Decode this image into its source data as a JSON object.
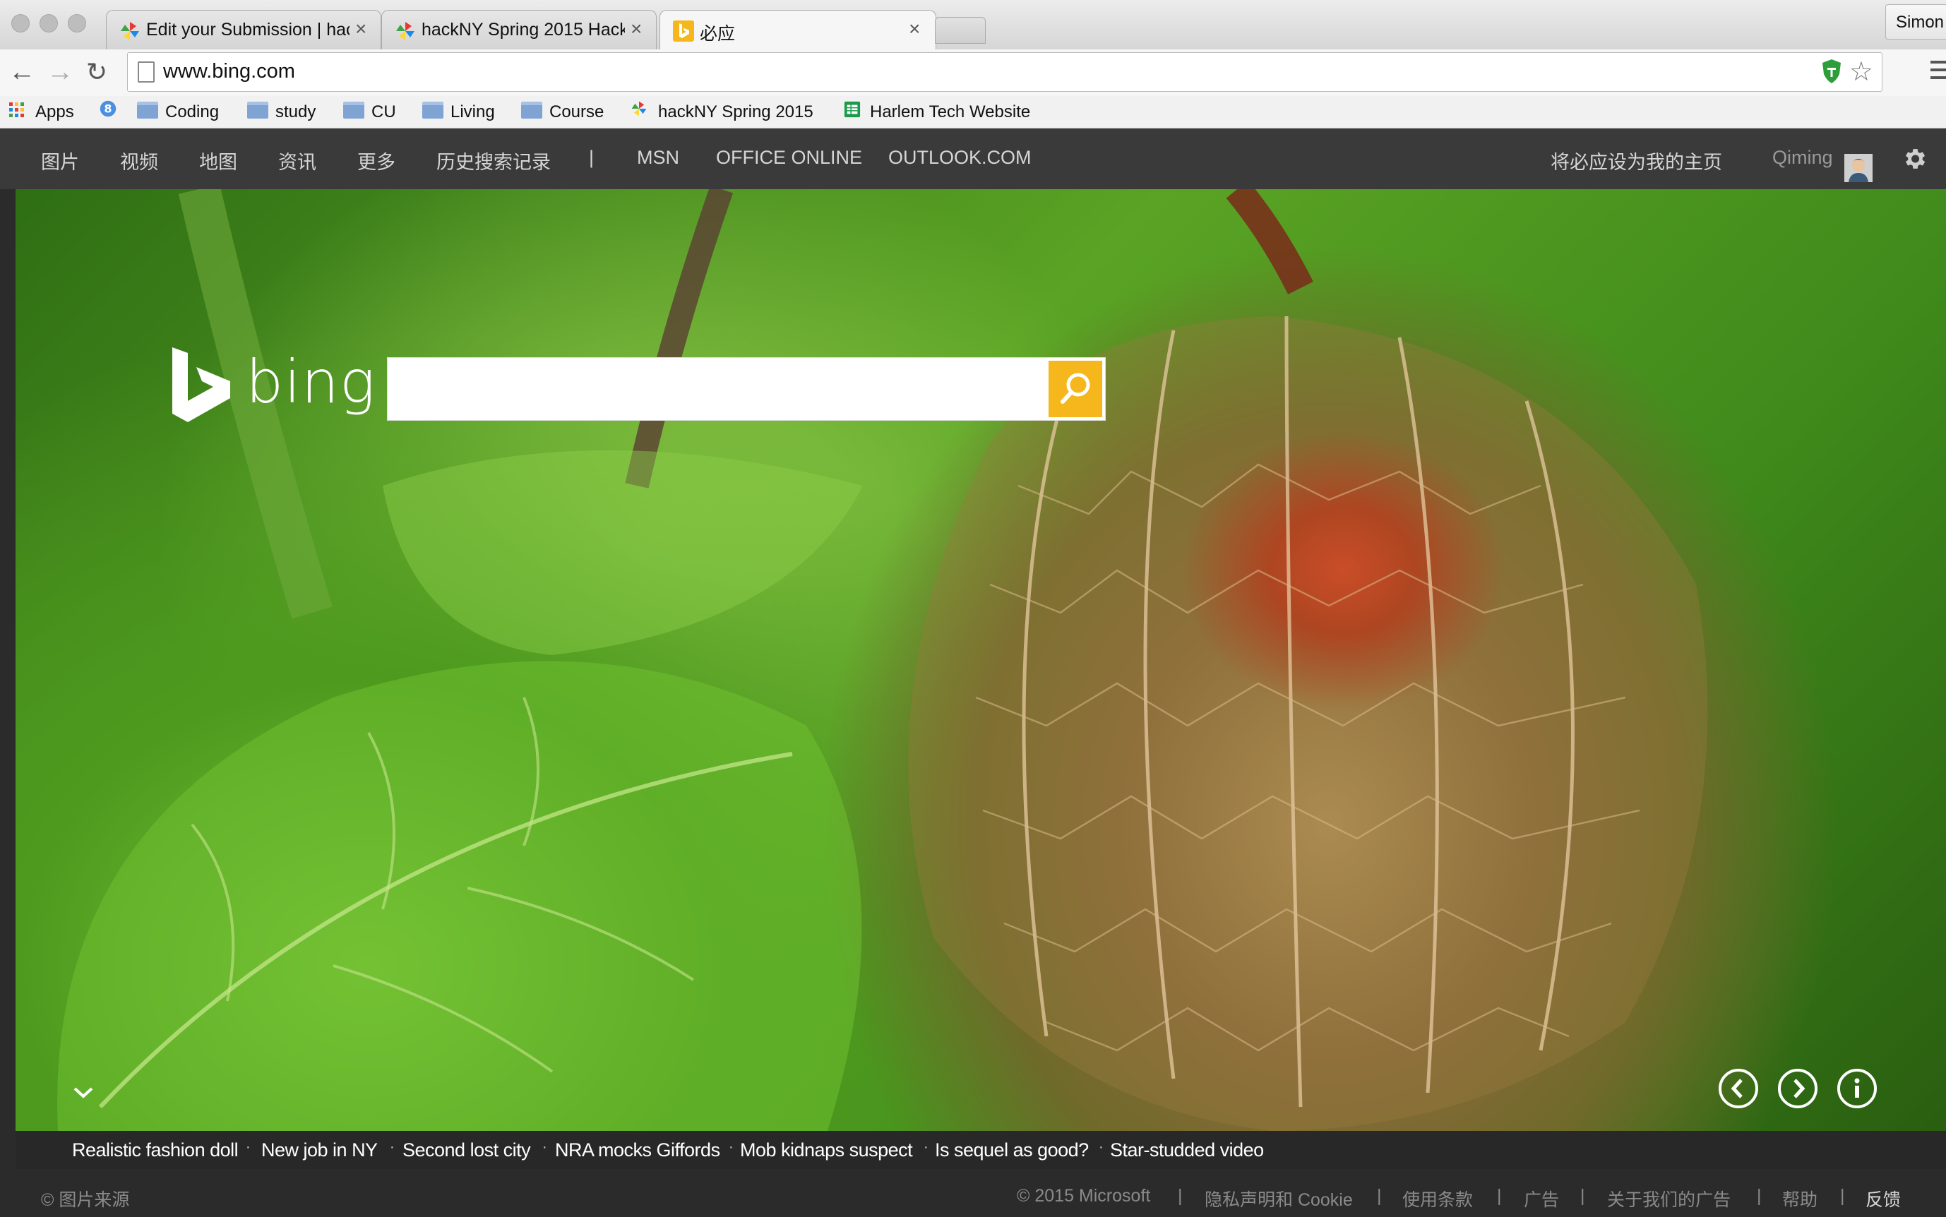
{
  "browser": {
    "tabs": [
      {
        "title": "Edit your Submission | hac",
        "icon": "hackny-pinwheel-icon"
      },
      {
        "title": "hackNY Spring 2015 Hacka",
        "icon": "hackny-pinwheel-icon"
      },
      {
        "title": "必应",
        "icon": "bing-favicon"
      }
    ],
    "profile_name": "Simon",
    "url": "www.bing.com",
    "bookmarks": [
      {
        "label": "Apps",
        "icon": "apps-grid-icon"
      },
      {
        "label": "",
        "icon": "blue-8-icon"
      },
      {
        "label": "Coding",
        "icon": "folder-icon"
      },
      {
        "label": "study",
        "icon": "folder-icon"
      },
      {
        "label": "CU",
        "icon": "folder-icon"
      },
      {
        "label": "Living",
        "icon": "folder-icon"
      },
      {
        "label": "Course",
        "icon": "folder-icon"
      },
      {
        "label": "hackNY Spring 2015",
        "icon": "hackny-pinwheel-icon"
      },
      {
        "label": "Harlem Tech Website",
        "icon": "sheets-icon"
      }
    ]
  },
  "header": {
    "nav": [
      "图片",
      "视频",
      "地图",
      "资讯",
      "更多",
      "历史搜索记录"
    ],
    "separator": "|",
    "links": [
      "MSN",
      "OFFICE ONLINE",
      "OUTLOOK.COM"
    ],
    "set_homepage": "将必应设为我的主页",
    "user_name": "Qiming"
  },
  "search": {
    "logo_text": "bing",
    "placeholder": ""
  },
  "news": [
    "Realistic fashion doll",
    "New job in NY",
    "Second lost city",
    "NRA mocks Giffords",
    "Mob kidnaps suspect",
    "Is sequel as good?",
    "Star-studded video"
  ],
  "footer": {
    "image_source": "© 图片来源",
    "links": [
      "© 2015 Microsoft",
      "隐私声明和 Cookie",
      "使用条款",
      "广告",
      "关于我们的广告",
      "帮助",
      "反馈"
    ],
    "separator": "|"
  },
  "colors": {
    "search_button": "#f5b71b",
    "header_bg": "#3a3a3a",
    "footer_bg": "#2b2b2b"
  }
}
